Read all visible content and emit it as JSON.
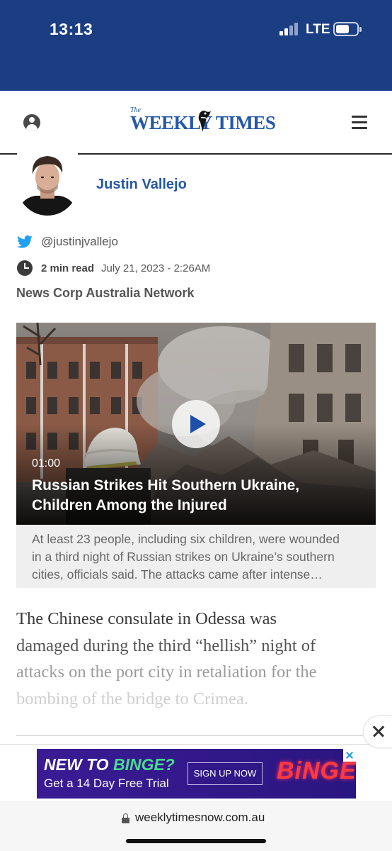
{
  "status_bar": {
    "time": "13:13",
    "network": "LTE"
  },
  "header": {
    "logo_small": "The",
    "logo_text": "WEEKLY TIMES"
  },
  "author": {
    "name": "Justin Vallejo",
    "twitter_handle": "@justinjvallejo",
    "read_time": "2 min read",
    "date": "July 21, 2023 - 2:26AM",
    "network": "News Corp Australia Network"
  },
  "video": {
    "duration": "01:00",
    "title_line1": "Russian Strikes Hit Southern Ukraine,",
    "title_line2": "Children Among the Injured",
    "summary_lines": [
      "At least 23 people, including six children, were wounded",
      "in a third night of Russian strikes on Ukraine’s southern",
      "cities, officials said. The attacks came after intense…"
    ]
  },
  "article": {
    "lead_lines": [
      "The Chinese consulate in Odessa was",
      "damaged during the third “hellish” night of",
      "attacks on the port city in retaliation for the",
      "bombing of the bridge to Crimea."
    ]
  },
  "ad": {
    "headline_white": "NEW TO ",
    "headline_green": "BINGE?",
    "subline": "Get a 14 Day Free Trial",
    "cta": "SIGN UP NOW",
    "brand": "BiNGE"
  },
  "url_bar": {
    "url": "weeklytimesnow.com.au"
  },
  "colors": {
    "brand_blue": "#2458a8",
    "status_bar": "#1b3d82",
    "ad_purple": "#3a1b94"
  }
}
